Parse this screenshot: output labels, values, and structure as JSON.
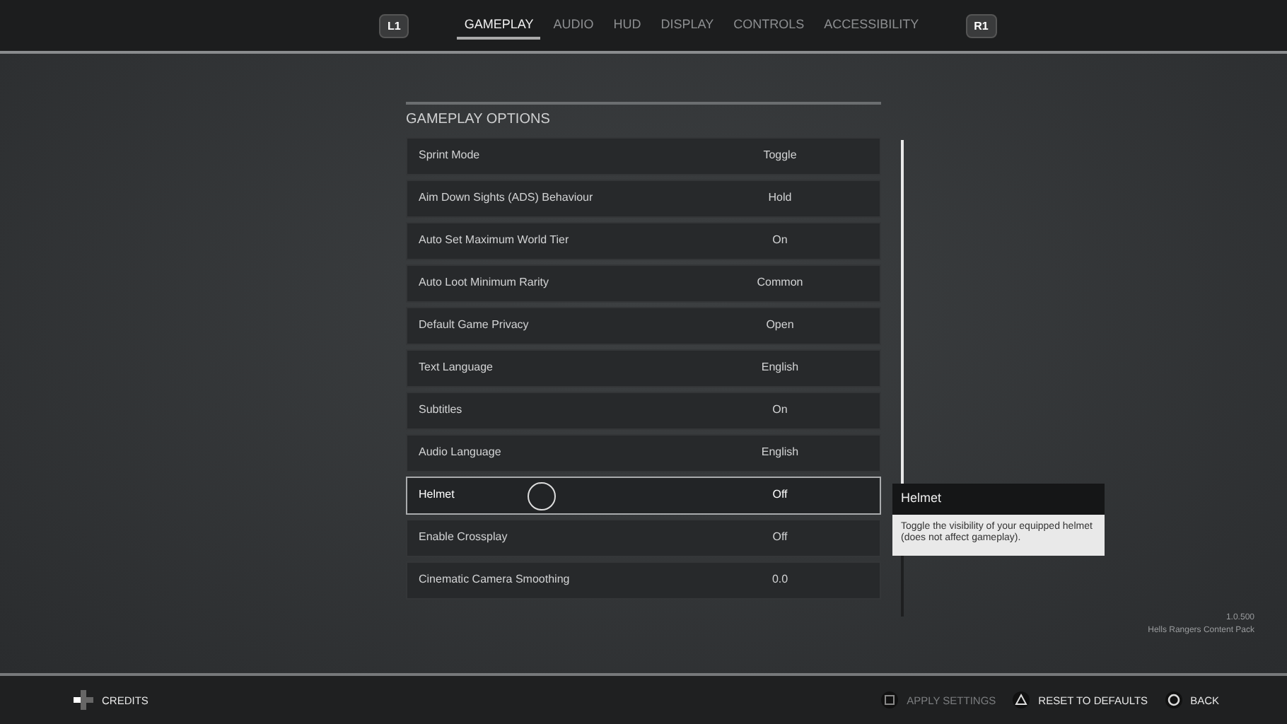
{
  "top_bar": {
    "left_bumper": "L1",
    "right_bumper": "R1",
    "tabs": [
      {
        "label": "GAMEPLAY",
        "selected": true
      },
      {
        "label": "AUDIO",
        "selected": false
      },
      {
        "label": "HUD",
        "selected": false
      },
      {
        "label": "DISPLAY",
        "selected": false
      },
      {
        "label": "CONTROLS",
        "selected": false
      },
      {
        "label": "ACCESSIBILITY",
        "selected": false
      }
    ]
  },
  "section_title": "GAMEPLAY OPTIONS",
  "options": [
    {
      "label": "Sprint Mode",
      "value": "Toggle",
      "selected": false
    },
    {
      "label": "Aim Down Sights (ADS) Behaviour",
      "value": "Hold",
      "selected": false
    },
    {
      "label": "Auto Set Maximum World Tier",
      "value": "On",
      "selected": false
    },
    {
      "label": "Auto Loot Minimum Rarity",
      "value": "Common",
      "selected": false
    },
    {
      "label": "Default Game Privacy",
      "value": "Open",
      "selected": false
    },
    {
      "label": "Text Language",
      "value": "English",
      "selected": false
    },
    {
      "label": "Subtitles",
      "value": "On",
      "selected": false
    },
    {
      "label": "Audio Language",
      "value": "English",
      "selected": false
    },
    {
      "label": "Helmet",
      "value": "Off",
      "selected": true
    },
    {
      "label": "Enable Crossplay",
      "value": "Off",
      "selected": false
    },
    {
      "label": "Cinematic Camera Smoothing",
      "value": "0.0",
      "selected": false
    }
  ],
  "tooltip": {
    "title": "Helmet",
    "text": "Toggle the visibility of your equipped helmet (does not affect gameplay)."
  },
  "version": "1.0.500",
  "content_pack": "Hells Rangers Content Pack",
  "footer": {
    "left": [
      {
        "kind": "dpad",
        "label": "CREDITS",
        "disabled": false
      }
    ],
    "right": [
      {
        "kind": "square",
        "label": "APPLY SETTINGS",
        "disabled": true
      },
      {
        "kind": "triangle",
        "label": "RESET TO DEFAULTS",
        "disabled": false
      },
      {
        "kind": "circle",
        "label": "BACK",
        "disabled": false
      }
    ]
  }
}
